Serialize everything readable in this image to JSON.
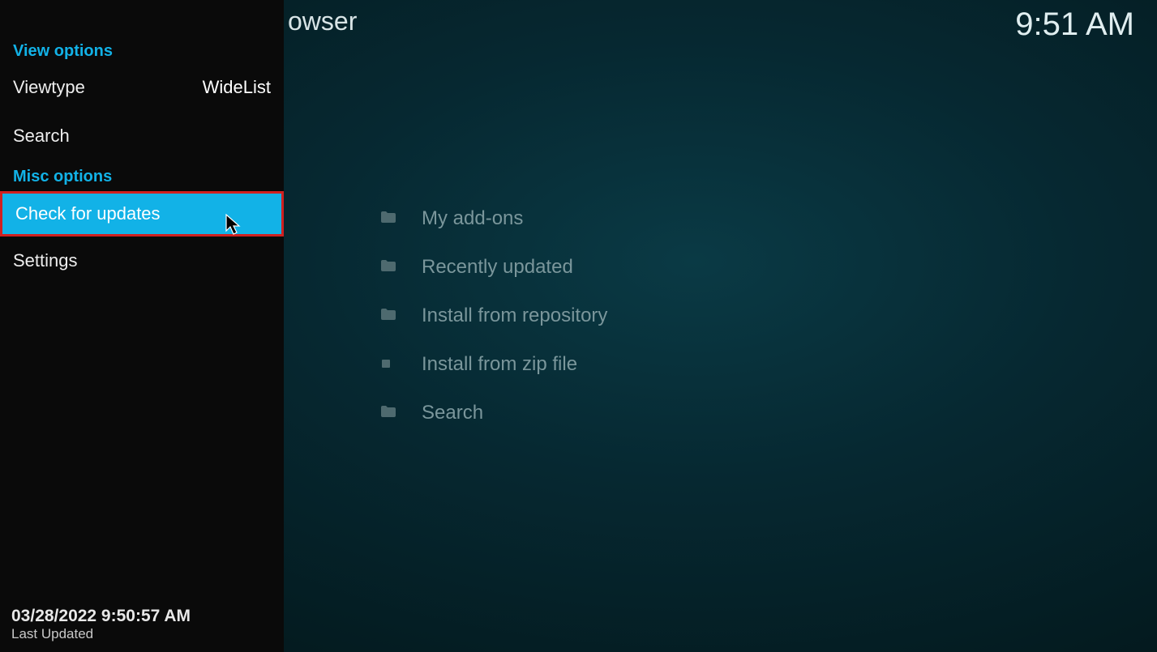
{
  "header": {
    "title_fragment": "owser"
  },
  "clock": "9:51 AM",
  "main_list": [
    {
      "icon": "folder-icon",
      "label": "My add-ons"
    },
    {
      "icon": "folder-icon",
      "label": "Recently updated"
    },
    {
      "icon": "folder-icon",
      "label": "Install from repository"
    },
    {
      "icon": "zip-icon",
      "label": "Install from zip file"
    },
    {
      "icon": "folder-icon",
      "label": "Search"
    }
  ],
  "sidebar": {
    "section_view": "View options",
    "viewtype_label": "Viewtype",
    "viewtype_value": "WideList",
    "search_label": "Search",
    "section_misc": "Misc options",
    "check_updates_label": "Check for updates",
    "settings_label": "Settings"
  },
  "footer": {
    "timestamp": "03/28/2022 9:50:57 AM",
    "label": "Last Updated"
  }
}
